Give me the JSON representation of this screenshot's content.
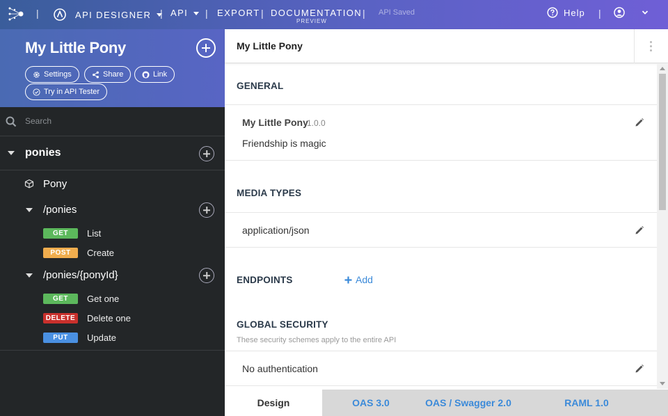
{
  "topbar": {
    "api_designer": "API DESIGNER",
    "api": "API",
    "export": "EXPORT",
    "documentation": "DOCUMENTATION",
    "preview": "PREVIEW",
    "status": "API Saved",
    "help": "Help",
    "separator": "|"
  },
  "sidebar": {
    "title": "My Little Pony",
    "buttons": {
      "settings": "Settings",
      "share": "Share",
      "link": "Link",
      "try": "Try in API Tester"
    },
    "search_placeholder": "Search",
    "group": "ponies",
    "model": "Pony",
    "resources": [
      {
        "path": "/ponies",
        "ops": [
          {
            "verb": "GET",
            "label": "List"
          },
          {
            "verb": "POST",
            "label": "Create"
          }
        ]
      },
      {
        "path": "/ponies/{ponyId}",
        "ops": [
          {
            "verb": "GET",
            "label": "Get one"
          },
          {
            "verb": "DELETE",
            "label": "Delete one"
          },
          {
            "verb": "PUT",
            "label": "Update"
          }
        ]
      }
    ]
  },
  "verb_colors": {
    "GET": "#5cb85c",
    "POST": "#f0ad4e",
    "DELETE": "#c9302c",
    "PUT": "#4a90e2"
  },
  "main": {
    "title": "My Little Pony",
    "general": {
      "heading": "GENERAL",
      "name": "My Little Pony",
      "version": "1.0.0",
      "description": "Friendship is magic"
    },
    "media_types": {
      "heading": "MEDIA TYPES",
      "value": "application/json"
    },
    "endpoints": {
      "heading": "ENDPOINTS",
      "add": "Add"
    },
    "security": {
      "heading": "GLOBAL SECURITY",
      "note": "These security schemes apply to the entire API",
      "value": "No authentication"
    }
  },
  "tabs": [
    "Design",
    "OAS 3.0",
    "OAS / Swagger 2.0",
    "RAML 1.0"
  ]
}
